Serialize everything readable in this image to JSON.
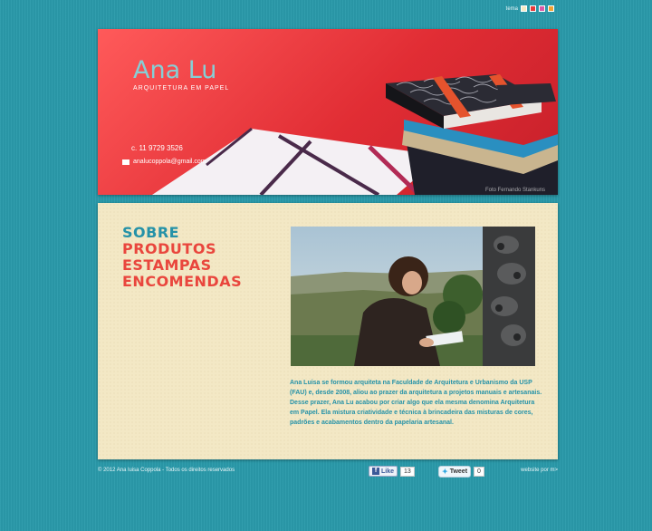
{
  "topbar": {
    "label": "tema",
    "swatches": [
      "#f6e9c4",
      "#e63a3a",
      "#d95aa7",
      "#f1a232"
    ]
  },
  "header": {
    "logo_title": "Ana Lu",
    "logo_subtitle": "ARQUITETURA EM PAPEL",
    "phone": "c. 11 9729 3526",
    "email": "analucoppola@gmail.com",
    "photo_credit": "Foto Fernando Stankuns"
  },
  "nav": {
    "items": [
      {
        "label": "SOBRE",
        "color": "#2592a8"
      },
      {
        "label": "PRODUTOS",
        "color": "#e9463d"
      },
      {
        "label": "ESTAMPAS",
        "color": "#e9463d"
      },
      {
        "label": "ENCOMENDAS",
        "color": "#e9463d"
      }
    ]
  },
  "about": {
    "text": "Ana Luisa se formou arquiteta na Faculdade de Arquitetura e Urbanismo da USP (FAU) e, desde 2008, aliou ao prazer da arquitetura a projetos manuais e artesanais. Desse prazer, Ana Lu acabou por criar algo que ela mesma denomina Arquitetura em Papel. Ela mistura criatividade e técnica à brincadeira das misturas de cores, padrões e acabamentos dentro da papelaria artesanal."
  },
  "footer": {
    "copyright": "© 2012 Ana luisa Coppola - Todos os direitos reservados",
    "like_label": "Like",
    "like_count": "13",
    "tweet_label": "Tweet",
    "tweet_count": "0",
    "credit": "website por m>"
  }
}
